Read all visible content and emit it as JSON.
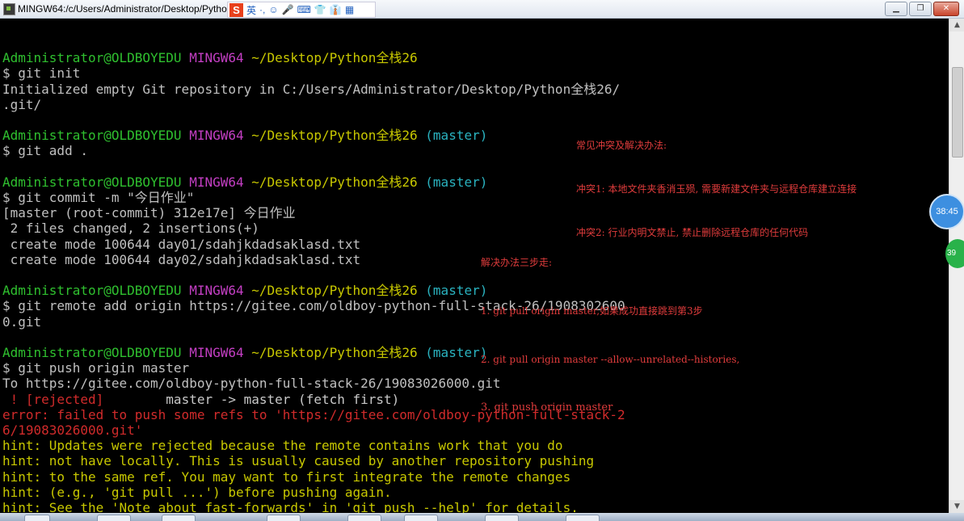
{
  "window": {
    "title": "MINGW64:/c/Users/Administrator/Desktop/Python"
  },
  "ime": {
    "logo": "S",
    "mode": "英",
    "items": [
      "·,",
      "☺",
      "🎤",
      "⌨",
      "👕",
      "👔",
      "▦"
    ]
  },
  "controls": {
    "minimize": "▁",
    "restore": "❐",
    "close": "✕"
  },
  "terminal": [
    {
      "text": ""
    },
    {
      "segments": [
        {
          "t": "Administrator@OLDBOYEDU",
          "c": "g"
        },
        {
          "t": " MINGW64",
          "c": "m"
        },
        {
          "t": " ~/Desktop/Python全栈26",
          "c": "y"
        }
      ]
    },
    {
      "text": "$ git init"
    },
    {
      "text": "Initialized empty Git repository in C:/Users/Administrator/Desktop/Python全栈26/"
    },
    {
      "text": ".git/"
    },
    {
      "text": ""
    },
    {
      "segments": [
        {
          "t": "Administrator@OLDBOYEDU",
          "c": "g"
        },
        {
          "t": " MINGW64",
          "c": "m"
        },
        {
          "t": " ~/Desktop/Python全栈26",
          "c": "y"
        },
        {
          "t": " (master)",
          "c": "c"
        }
      ]
    },
    {
      "text": "$ git add ."
    },
    {
      "text": ""
    },
    {
      "segments": [
        {
          "t": "Administrator@OLDBOYEDU",
          "c": "g"
        },
        {
          "t": " MINGW64",
          "c": "m"
        },
        {
          "t": " ~/Desktop/Python全栈26",
          "c": "y"
        },
        {
          "t": " (master)",
          "c": "c"
        }
      ]
    },
    {
      "text": "$ git commit -m \"今日作业\""
    },
    {
      "text": "[master (root-commit) 312e17e] 今日作业"
    },
    {
      "text": " 2 files changed, 2 insertions(+)"
    },
    {
      "text": " create mode 100644 day01/sdahjkdadsaklasd.txt"
    },
    {
      "text": " create mode 100644 day02/sdahjkdadsaklasd.txt"
    },
    {
      "text": ""
    },
    {
      "segments": [
        {
          "t": "Administrator@OLDBOYEDU",
          "c": "g"
        },
        {
          "t": " MINGW64",
          "c": "m"
        },
        {
          "t": " ~/Desktop/Python全栈26",
          "c": "y"
        },
        {
          "t": " (master)",
          "c": "c"
        }
      ]
    },
    {
      "text": "$ git remote add origin https://gitee.com/oldboy-python-full-stack-26/1908302600"
    },
    {
      "text": "0.git"
    },
    {
      "text": ""
    },
    {
      "segments": [
        {
          "t": "Administrator@OLDBOYEDU",
          "c": "g"
        },
        {
          "t": " MINGW64",
          "c": "m"
        },
        {
          "t": " ~/Desktop/Python全栈26",
          "c": "y"
        },
        {
          "t": " (master)",
          "c": "c"
        }
      ]
    },
    {
      "text": "$ git push origin master"
    },
    {
      "text": "To https://gitee.com/oldboy-python-full-stack-26/19083026000.git"
    },
    {
      "segments": [
        {
          "t": " ! [rejected]",
          "c": "r"
        },
        {
          "t": "        master -> master (fetch first)",
          "c": "w"
        }
      ]
    },
    {
      "segments": [
        {
          "t": "error: failed to push some refs to 'https://gitee.com/oldboy-python-full-stack-2",
          "c": "r"
        }
      ]
    },
    {
      "segments": [
        {
          "t": "6/19083026000.git'",
          "c": "r"
        }
      ]
    },
    {
      "segments": [
        {
          "t": "hint: Updates were rejected because the remote contains work that you do",
          "c": "y"
        }
      ]
    },
    {
      "segments": [
        {
          "t": "hint: not have locally. This is usually caused by another repository pushing",
          "c": "y"
        }
      ]
    },
    {
      "segments": [
        {
          "t": "hint: to the same ref. You may want to first integrate the remote changes",
          "c": "y"
        }
      ]
    },
    {
      "segments": [
        {
          "t": "hint: (e.g., 'git pull ...') before pushing again.",
          "c": "y"
        }
      ]
    },
    {
      "segments": [
        {
          "t": "hint: See the 'Note about fast-forwards' in 'git push --help' for details.",
          "c": "y"
        }
      ]
    }
  ],
  "annotations": {
    "conflicts": [
      "常见冲突及解决办法:",
      "冲突1: 本地文件夹香消玉殒, 需要新建文件夹与远程仓库建立连接",
      "冲突2: 行业内明文禁止, 禁止删除远程仓库的任何代码"
    ],
    "steps": [
      "解决办法三步走:",
      "1. git pull origin master,如果成功直接跳到第3步",
      "2. git pull origin master --allow--unrelated--histories,",
      "3. git push origin master"
    ]
  },
  "overlay": {
    "clock": "38:45",
    "badge": "39"
  },
  "colors": {
    "green": "#2fc02f",
    "magenta": "#c43fc4",
    "yellow": "#c8c800",
    "cyan": "#2ab3c0",
    "red": "#d12b2b",
    "note_red": "#e03c3c"
  }
}
